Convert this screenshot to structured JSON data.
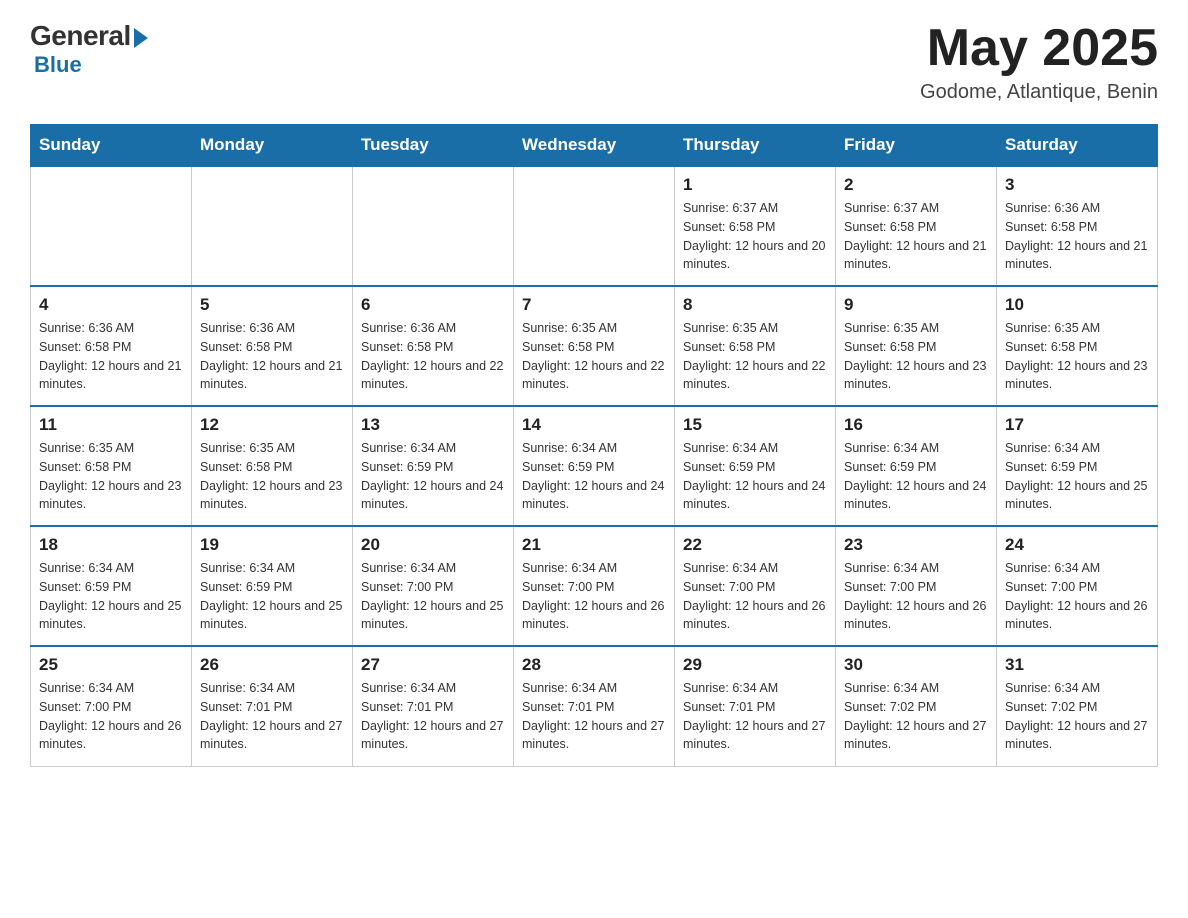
{
  "logo": {
    "general": "General",
    "blue": "Blue"
  },
  "title": {
    "month_year": "May 2025",
    "location": "Godome, Atlantique, Benin"
  },
  "weekdays": [
    "Sunday",
    "Monday",
    "Tuesday",
    "Wednesday",
    "Thursday",
    "Friday",
    "Saturday"
  ],
  "weeks": [
    [
      {
        "day": "",
        "info": ""
      },
      {
        "day": "",
        "info": ""
      },
      {
        "day": "",
        "info": ""
      },
      {
        "day": "",
        "info": ""
      },
      {
        "day": "1",
        "info": "Sunrise: 6:37 AM\nSunset: 6:58 PM\nDaylight: 12 hours and 20 minutes."
      },
      {
        "day": "2",
        "info": "Sunrise: 6:37 AM\nSunset: 6:58 PM\nDaylight: 12 hours and 21 minutes."
      },
      {
        "day": "3",
        "info": "Sunrise: 6:36 AM\nSunset: 6:58 PM\nDaylight: 12 hours and 21 minutes."
      }
    ],
    [
      {
        "day": "4",
        "info": "Sunrise: 6:36 AM\nSunset: 6:58 PM\nDaylight: 12 hours and 21 minutes."
      },
      {
        "day": "5",
        "info": "Sunrise: 6:36 AM\nSunset: 6:58 PM\nDaylight: 12 hours and 21 minutes."
      },
      {
        "day": "6",
        "info": "Sunrise: 6:36 AM\nSunset: 6:58 PM\nDaylight: 12 hours and 22 minutes."
      },
      {
        "day": "7",
        "info": "Sunrise: 6:35 AM\nSunset: 6:58 PM\nDaylight: 12 hours and 22 minutes."
      },
      {
        "day": "8",
        "info": "Sunrise: 6:35 AM\nSunset: 6:58 PM\nDaylight: 12 hours and 22 minutes."
      },
      {
        "day": "9",
        "info": "Sunrise: 6:35 AM\nSunset: 6:58 PM\nDaylight: 12 hours and 23 minutes."
      },
      {
        "day": "10",
        "info": "Sunrise: 6:35 AM\nSunset: 6:58 PM\nDaylight: 12 hours and 23 minutes."
      }
    ],
    [
      {
        "day": "11",
        "info": "Sunrise: 6:35 AM\nSunset: 6:58 PM\nDaylight: 12 hours and 23 minutes."
      },
      {
        "day": "12",
        "info": "Sunrise: 6:35 AM\nSunset: 6:58 PM\nDaylight: 12 hours and 23 minutes."
      },
      {
        "day": "13",
        "info": "Sunrise: 6:34 AM\nSunset: 6:59 PM\nDaylight: 12 hours and 24 minutes."
      },
      {
        "day": "14",
        "info": "Sunrise: 6:34 AM\nSunset: 6:59 PM\nDaylight: 12 hours and 24 minutes."
      },
      {
        "day": "15",
        "info": "Sunrise: 6:34 AM\nSunset: 6:59 PM\nDaylight: 12 hours and 24 minutes."
      },
      {
        "day": "16",
        "info": "Sunrise: 6:34 AM\nSunset: 6:59 PM\nDaylight: 12 hours and 24 minutes."
      },
      {
        "day": "17",
        "info": "Sunrise: 6:34 AM\nSunset: 6:59 PM\nDaylight: 12 hours and 25 minutes."
      }
    ],
    [
      {
        "day": "18",
        "info": "Sunrise: 6:34 AM\nSunset: 6:59 PM\nDaylight: 12 hours and 25 minutes."
      },
      {
        "day": "19",
        "info": "Sunrise: 6:34 AM\nSunset: 6:59 PM\nDaylight: 12 hours and 25 minutes."
      },
      {
        "day": "20",
        "info": "Sunrise: 6:34 AM\nSunset: 7:00 PM\nDaylight: 12 hours and 25 minutes."
      },
      {
        "day": "21",
        "info": "Sunrise: 6:34 AM\nSunset: 7:00 PM\nDaylight: 12 hours and 26 minutes."
      },
      {
        "day": "22",
        "info": "Sunrise: 6:34 AM\nSunset: 7:00 PM\nDaylight: 12 hours and 26 minutes."
      },
      {
        "day": "23",
        "info": "Sunrise: 6:34 AM\nSunset: 7:00 PM\nDaylight: 12 hours and 26 minutes."
      },
      {
        "day": "24",
        "info": "Sunrise: 6:34 AM\nSunset: 7:00 PM\nDaylight: 12 hours and 26 minutes."
      }
    ],
    [
      {
        "day": "25",
        "info": "Sunrise: 6:34 AM\nSunset: 7:00 PM\nDaylight: 12 hours and 26 minutes."
      },
      {
        "day": "26",
        "info": "Sunrise: 6:34 AM\nSunset: 7:01 PM\nDaylight: 12 hours and 27 minutes."
      },
      {
        "day": "27",
        "info": "Sunrise: 6:34 AM\nSunset: 7:01 PM\nDaylight: 12 hours and 27 minutes."
      },
      {
        "day": "28",
        "info": "Sunrise: 6:34 AM\nSunset: 7:01 PM\nDaylight: 12 hours and 27 minutes."
      },
      {
        "day": "29",
        "info": "Sunrise: 6:34 AM\nSunset: 7:01 PM\nDaylight: 12 hours and 27 minutes."
      },
      {
        "day": "30",
        "info": "Sunrise: 6:34 AM\nSunset: 7:02 PM\nDaylight: 12 hours and 27 minutes."
      },
      {
        "day": "31",
        "info": "Sunrise: 6:34 AM\nSunset: 7:02 PM\nDaylight: 12 hours and 27 minutes."
      }
    ]
  ]
}
